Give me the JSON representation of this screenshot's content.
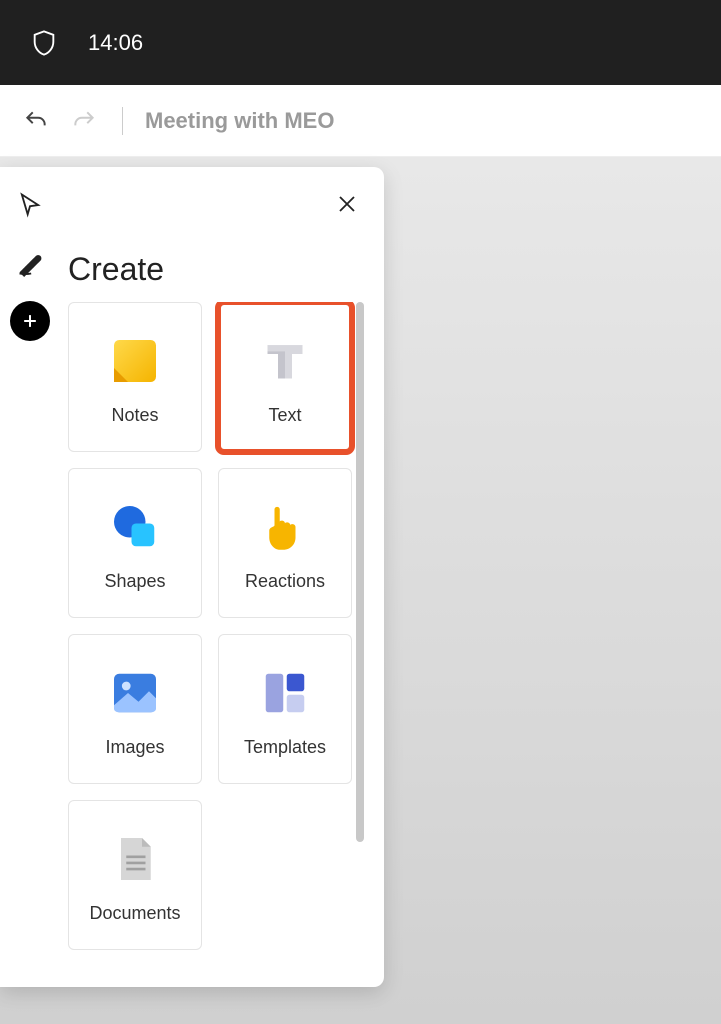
{
  "status": {
    "time": "14:06"
  },
  "toolbar": {
    "title": "Meeting with MEO"
  },
  "panel": {
    "title": "Create",
    "items": [
      {
        "label": "Notes"
      },
      {
        "label": "Text"
      },
      {
        "label": "Shapes"
      },
      {
        "label": "Reactions"
      },
      {
        "label": "Images"
      },
      {
        "label": "Templates"
      },
      {
        "label": "Documents"
      }
    ]
  }
}
